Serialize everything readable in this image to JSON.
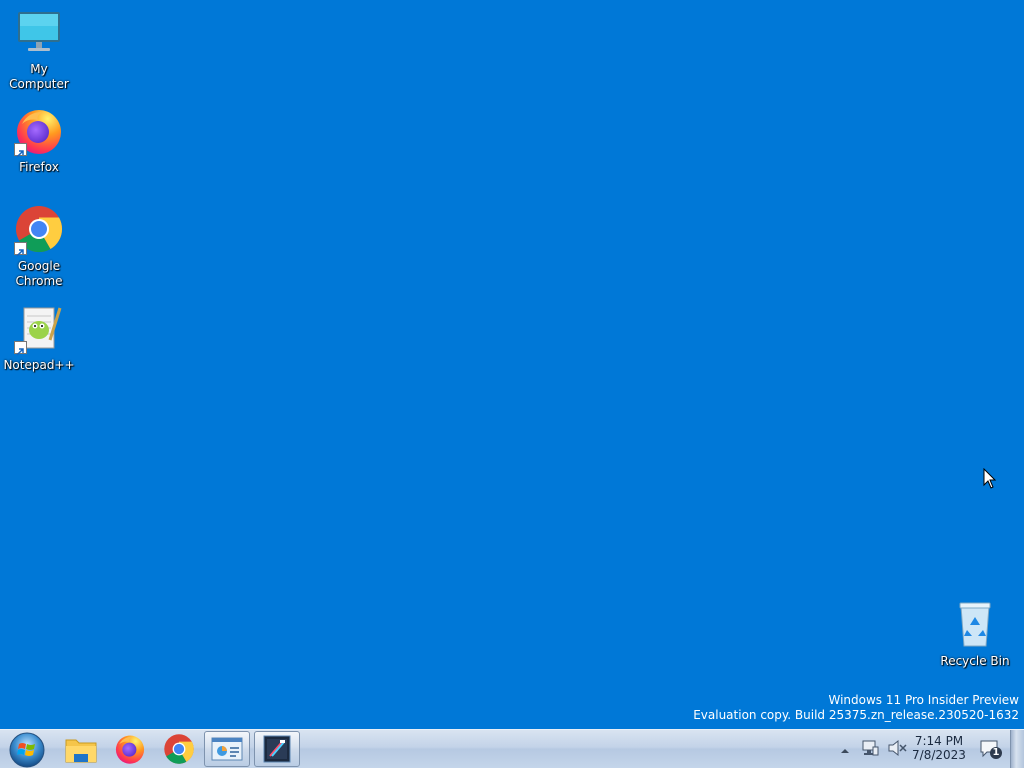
{
  "desktop": {
    "background_color": "#0078d7",
    "icons": [
      {
        "label": "My Computer"
      },
      {
        "label": "Firefox"
      },
      {
        "label": "Google Chrome"
      },
      {
        "label": "Notepad++"
      },
      {
        "label": "Recycle Bin"
      }
    ],
    "watermark": {
      "line1": "Windows 11 Pro Insider Preview",
      "line2": "Evaluation copy. Build 25375.zn_release.230520-1632"
    }
  },
  "taskbar": {
    "start_icon": "windows-start-orb-icon",
    "pinned": [
      {
        "icon": "file-explorer-icon"
      },
      {
        "icon": "firefox-icon"
      },
      {
        "icon": "chrome-icon"
      },
      {
        "icon": "control-panel-icon"
      },
      {
        "icon": "app-window-icon"
      }
    ],
    "tray": {
      "time": "7:14 PM",
      "date": "7/8/2023",
      "notification_count": "1"
    }
  }
}
